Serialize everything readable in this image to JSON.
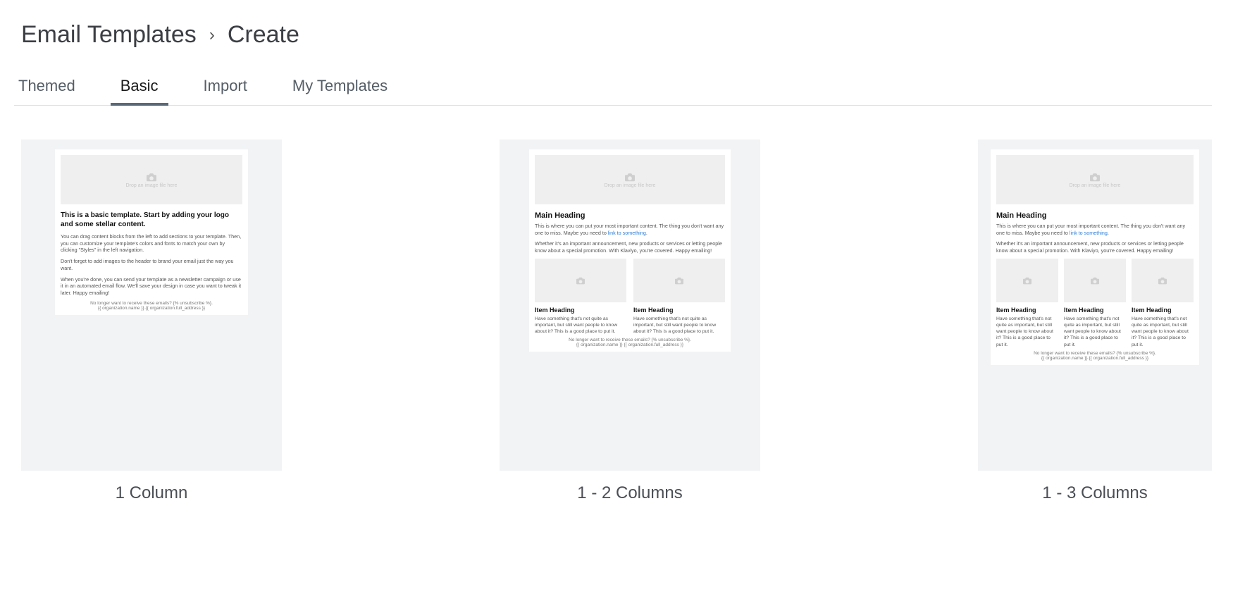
{
  "breadcrumb": {
    "root": "Email Templates",
    "current": "Create"
  },
  "tabs": {
    "themed": "Themed",
    "basic": "Basic",
    "import": "Import",
    "myTemplates": "My Templates"
  },
  "placeholder": {
    "drop": "Drop an image file here"
  },
  "footer": {
    "unsub": "No longer want to receive these emails? {% unsubscribe %}.",
    "org": "{{ organization.name }} {{ organization.full_address }}"
  },
  "cards": {
    "one": {
      "label": "1 Column",
      "title": "This is a basic template. Start by adding your logo and some stellar content.",
      "p1": "You can drag content blocks from the left to add sections to your template. Then, you can customize your template's colors and fonts to match your own by clicking \"Styles\" in the left navigation.",
      "p2": "Don't forget to add images to the header to brand your email just the way you want.",
      "p3": "When you're done, you can send your template as a newsletter campaign or use it in an automated email flow. We'll save your design in case you want to tweak it later. Happy emailing!"
    },
    "two": {
      "label": "1 - 2 Columns",
      "heading": "Main Heading",
      "p1a": "This is where you can put your most important content. The thing you don't want any one to miss. Maybe you need to ",
      "link": "link to something",
      "p1b": ".",
      "p2": "Whether it's an important announcement, new products or services or letting people know about a special promotion. With Klaviyo, you're covered. Happy emailing!",
      "itemHeading": "Item Heading",
      "itemBody": "Have something that's not quite as important, but still want people to know about it? This is a good place to put it."
    },
    "three": {
      "label": "1 - 3 Columns",
      "heading": "Main Heading",
      "p1a": "This is where you can put your most important content. The thing you don't want any one to miss. Maybe you need to ",
      "link": "link to something",
      "p1b": ".",
      "p2": "Whether it's an important announcement, new products or services or letting people know about a special promotion. With Klaviyo, you're covered. Happy emailing!",
      "itemHeading": "Item Heading",
      "itemBody": "Have something that's not quite as important, but still want people to know about it? This is a good place to put it."
    }
  }
}
